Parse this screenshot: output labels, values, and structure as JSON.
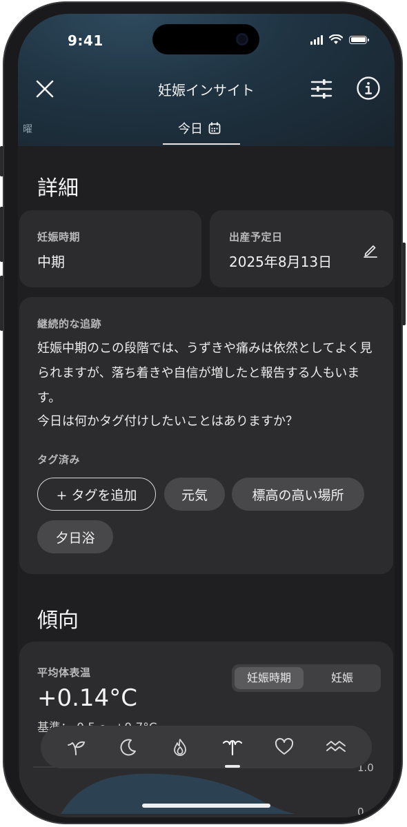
{
  "status_bar": {
    "time": "9:41"
  },
  "header": {
    "title": "妊娠インサイト",
    "tab_left_partial": "曜",
    "tab_today": "今日"
  },
  "details": {
    "section_title": "詳細",
    "phase_card": {
      "label": "妊娠時期",
      "value": "中期"
    },
    "due_card": {
      "label": "出産予定日",
      "value": "2025年8月13日"
    }
  },
  "tracking": {
    "label": "継続的な追跡",
    "paragraph": "妊娠中期のこの段階では、うずきや痛みは依然としてよく見られますが、落ち着きや自信が増したと報告する人もいます。",
    "question": "今日は何かタグ付けしたいことはありますか？",
    "tagged_label": "タグ済み",
    "add_tag": "+ タグを追加",
    "tags": [
      "元気",
      "標高の高い場所",
      "夕日浴"
    ]
  },
  "trends": {
    "section_title": "傾向",
    "metric_label": "平均体表温",
    "metric_value": "+0.14°C",
    "baseline_partial": "基準：-0.5 ～ +0.7°C",
    "segment": [
      "妊娠時期",
      "妊娠"
    ],
    "axis_label_top": "1.0",
    "axis_label_bottom": "0"
  },
  "bottom_nav": {
    "items": [
      "sprout-icon",
      "moon-icon",
      "flame-icon",
      "pregnancy-icon",
      "heart-icon",
      "waves-icon"
    ],
    "active": "pregnancy-icon"
  },
  "colors": {
    "background": "#1f1f21",
    "card": "#2c2c2e",
    "header_top": "#2e4a5d",
    "chip": "#48484b"
  }
}
